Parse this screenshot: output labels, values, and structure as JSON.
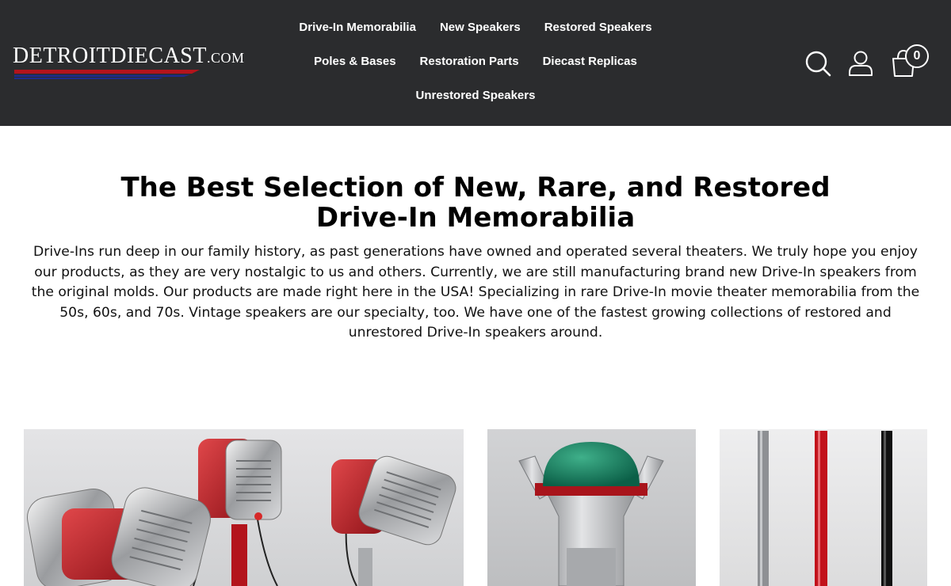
{
  "header": {
    "logo_text_main": "DetroitDiecast",
    "logo_text_suffix": ".com",
    "nav": {
      "drive_in_memorabilia": "Drive-In Memorabilia",
      "new_speakers": "New Speakers",
      "restored_speakers": "Restored Speakers",
      "poles_bases": "Poles & Bases",
      "restoration_parts": "Restoration Parts",
      "diecast_replicas": "Diecast Replicas",
      "unrestored_speakers": "Unrestored Speakers"
    },
    "icons": [
      "search-icon",
      "user-icon",
      "shopping-bag-icon"
    ],
    "cart_count": "0"
  },
  "hero": {
    "title": "The Best Selection of New, Rare, and Restored Drive-In Memorabilia",
    "body": "Drive-Ins run deep in our family history, as past generations have owned and operated several theaters. We truly hope you enjoy our products, as they are very nostalgic to us and others. Currently, we are still manufacturing brand new Drive-In speakers from the original molds. Our products are made right here in the USA! Specializing in rare Drive-In movie theater memorabilia from the 50s, 60s, and 70s. Vintage speakers are our specialty, too. We have one of the fastest growing collections of restored and unrestored Drive-In speakers around."
  },
  "colors": {
    "header_bg": "#2b2c2e",
    "header_text": "#ffffff",
    "logo_stripe_red": "#b3141c",
    "logo_stripe_blue": "#1d2c8c"
  }
}
